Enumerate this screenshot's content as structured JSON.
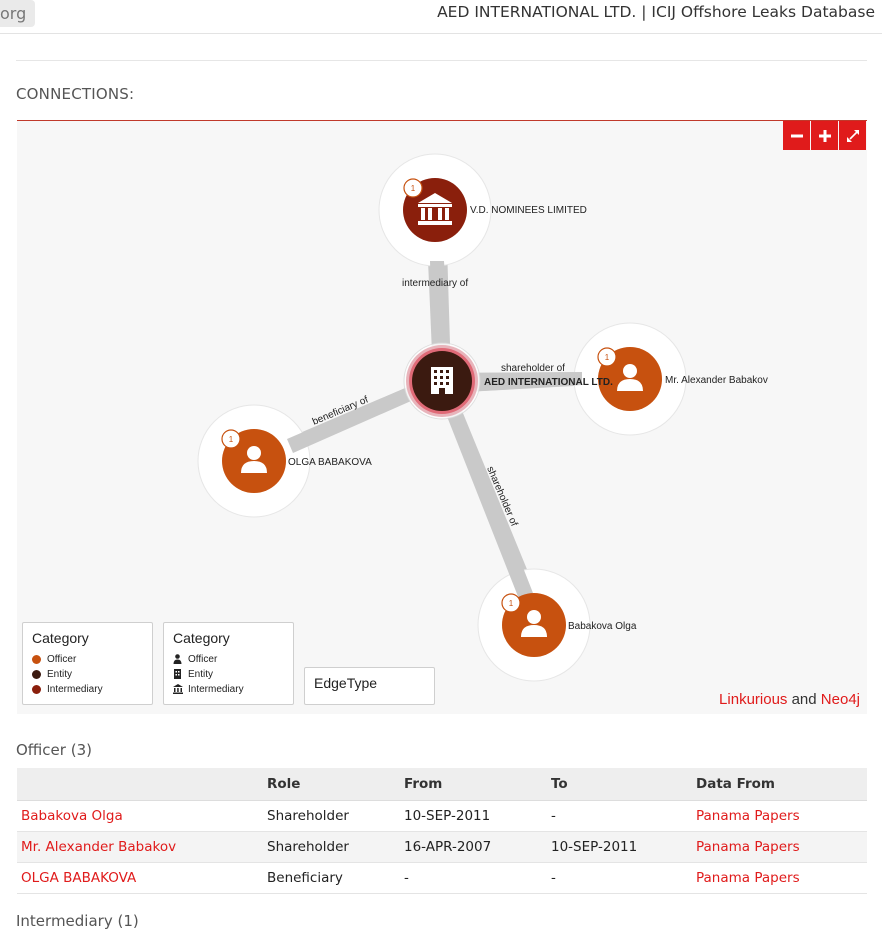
{
  "header": {
    "tab_fragment": "org",
    "title": "AED INTERNATIONAL LTD. | ICIJ Offshore Leaks Database"
  },
  "connections": {
    "label": "CONNECTIONS:",
    "controls": {
      "zoom_out_icon": "minus-icon",
      "zoom_in_icon": "plus-icon",
      "fullscreen_icon": "expand-icon"
    },
    "nodes": {
      "center": {
        "label": "AED INTERNATIONAL LTD.",
        "type": "entity",
        "icon": "building-icon"
      },
      "intermediary": {
        "label": "V.D. NOMINEES LIMITED",
        "count": "1",
        "type": "intermediary",
        "icon": "bank-icon"
      },
      "alexander": {
        "label": "Mr. Alexander Babakov",
        "count": "1",
        "type": "officer",
        "icon": "person-icon"
      },
      "olga_upper": {
        "label": "OLGA BABAKOVA",
        "count": "1",
        "type": "officer",
        "icon": "person-icon"
      },
      "olga": {
        "label": "Babakova Olga",
        "count": "1",
        "type": "officer",
        "icon": "person-icon"
      }
    },
    "edges": {
      "intermediary": "intermediary of",
      "alexander": "shareholder of",
      "olga_upper": "beneficiary of",
      "olga": "shareholder of"
    },
    "legend_color": {
      "title": "Category",
      "items": [
        {
          "label": "Officer",
          "color": "#c7510f"
        },
        {
          "label": "Entity",
          "color": "#3b1a10"
        },
        {
          "label": "Intermediary",
          "color": "#8a1f0c"
        }
      ]
    },
    "legend_icon": {
      "title": "Category",
      "items": [
        {
          "label": "Officer",
          "icon": "person-icon"
        },
        {
          "label": "Entity",
          "icon": "building-icon"
        },
        {
          "label": "Intermediary",
          "icon": "bank-icon"
        }
      ]
    },
    "legend_edge": {
      "title": "EdgeType"
    },
    "credit": {
      "link1": "Linkurious",
      "and": "and",
      "link2": "Neo4j"
    },
    "colors": {
      "accent": "#e01b1b",
      "officer": "#c7510f",
      "entity": "#3b1a10",
      "intermediary": "#8a1f0c"
    }
  },
  "officers": {
    "title": "Officer (3)",
    "columns": [
      "",
      "Role",
      "From",
      "To",
      "Data From"
    ],
    "rows": [
      {
        "name": "Babakova Olga",
        "role": "Shareholder",
        "from": "10-SEP-2011",
        "to": "-",
        "source": "Panama Papers"
      },
      {
        "name": "Mr. Alexander Babakov",
        "role": "Shareholder",
        "from": "16-APR-2007",
        "to": "10-SEP-2011",
        "source": "Panama Papers"
      },
      {
        "name": "OLGA BABAKOVA",
        "role": "Beneficiary",
        "from": "-",
        "to": "-",
        "source": "Panama Papers"
      }
    ]
  },
  "intermediary_section": {
    "title": "Intermediary (1)"
  }
}
